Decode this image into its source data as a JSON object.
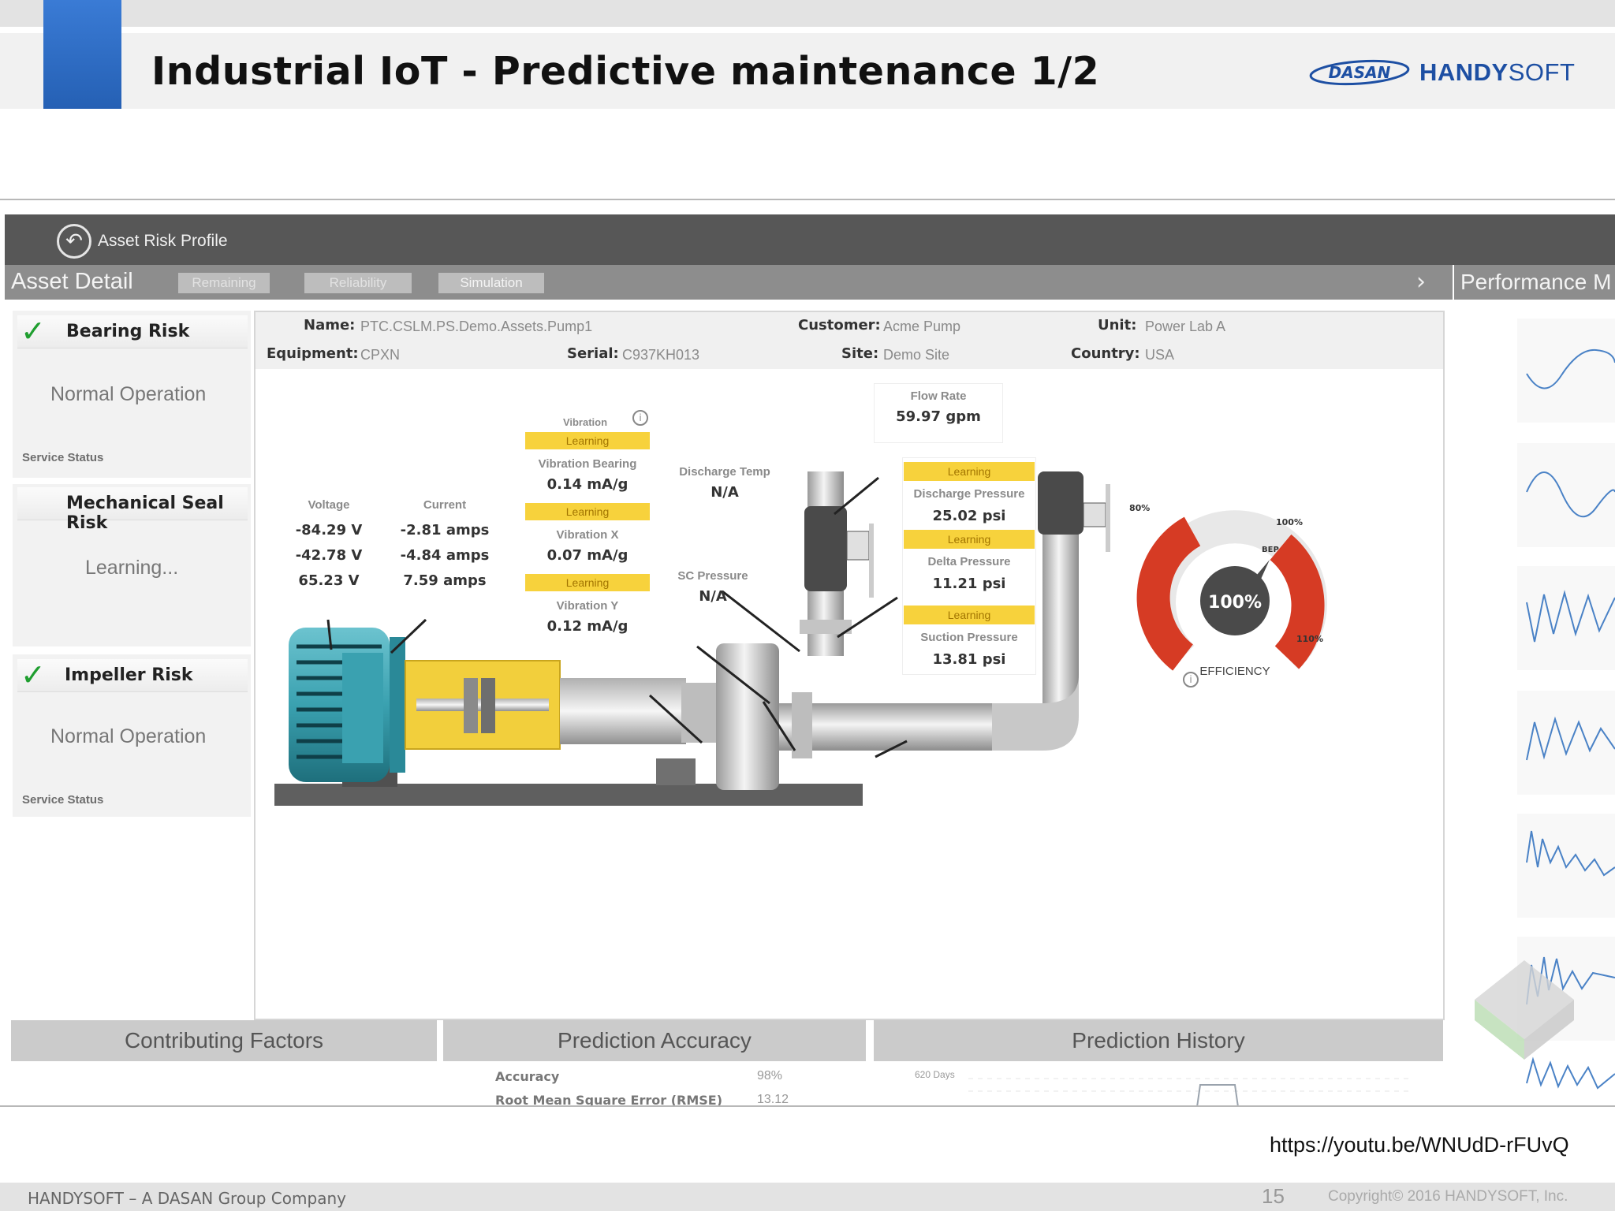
{
  "slide": {
    "title": "Industrial IoT - Predictive maintenance 1/2",
    "logo_dasan": "DASAN",
    "logo_handy": "HANDY",
    "logo_soft": "SOFT",
    "video_url": "https://youtu.be/WNUdD-rFUvQ",
    "footer_left": "HANDYSOFT – A DASAN Group Company",
    "page_number": "15",
    "copyright": "Copyright© 2016 HANDYSOFT, Inc."
  },
  "app": {
    "header_title": "Asset Risk Profile",
    "tabbar_title": "Asset Detail",
    "tabs": [
      {
        "label": "Remaining"
      },
      {
        "label": "Reliability"
      },
      {
        "label": "Simulation"
      }
    ],
    "performance_title": "Performance M",
    "risks": [
      {
        "label": "Bearing Risk",
        "status": "Normal Operation",
        "service": "Service Status",
        "checked": true
      },
      {
        "label": "Mechanical Seal Risk",
        "status": "Learning...",
        "service": "",
        "checked": false
      },
      {
        "label": "Impeller Risk",
        "status": "Normal Operation",
        "service": "Service Status",
        "checked": true
      }
    ],
    "asset": {
      "name_k": "Name:",
      "name_v": "PTC.CSLM.PS.Demo.Assets.Pump1",
      "customer_k": "Customer:",
      "customer_v": "Acme Pump",
      "unit_k": "Unit:",
      "unit_v": "Power Lab A",
      "equipment_k": "Equipment:",
      "equipment_v": "CPXN",
      "serial_k": "Serial:",
      "serial_v": "C937KH013",
      "site_k": "Site:",
      "site_v": "Demo Site",
      "country_k": "Country:",
      "country_v": "USA"
    },
    "sensors": {
      "voltage_label": "Voltage",
      "voltage_values": [
        "-84.29 V",
        "-42.78 V",
        "65.23 V"
      ],
      "current_label": "Current",
      "current_values": [
        "-2.81 amps",
        "-4.84 amps",
        "7.59 amps"
      ],
      "vibration_title": "Vibration",
      "learning": "Learning",
      "vib_bearing_label": "Vibration Bearing",
      "vib_bearing_value": "0.14 mA/g",
      "vib_x_label": "Vibration X",
      "vib_x_value": "0.07 mA/g",
      "vib_y_label": "Vibration Y",
      "vib_y_value": "0.12 mA/g",
      "discharge_temp_label": "Discharge Temp",
      "discharge_temp_value": "N/A",
      "sc_pressure_label": "SC Pressure",
      "sc_pressure_value": "N/A",
      "flow_rate_label": "Flow Rate",
      "flow_rate_value": "59.97 gpm",
      "discharge_pressure_label": "Discharge Pressure",
      "discharge_pressure_value": "25.02 psi",
      "delta_pressure_label": "Delta Pressure",
      "delta_pressure_value": "11.21 psi",
      "suction_pressure_label": "Suction Pressure",
      "suction_pressure_value": "13.81 psi"
    },
    "gauge": {
      "value_text": "100%",
      "value": 1.0,
      "label": "EFFICIENCY",
      "mark_80": "80%",
      "mark_100": "100%",
      "mark_bep": "BEP",
      "mark_110": "110%"
    },
    "tiles": {
      "contributing": "Contributing Factors",
      "accuracy": "Prediction Accuracy",
      "history": "Prediction History",
      "accuracy_k": "Accuracy",
      "accuracy_v": "98%",
      "rmse_k": "Root Mean Square Error (RMSE)",
      "rmse_v": "13.12",
      "history_axis": "620 Days"
    }
  },
  "colors": {
    "accent_blue": "#2560b4",
    "learning_yellow": "#f7d23c",
    "check_green": "#1f9e2f",
    "gauge_red": "#d63b24",
    "motor_teal": "#3aa1b0"
  }
}
